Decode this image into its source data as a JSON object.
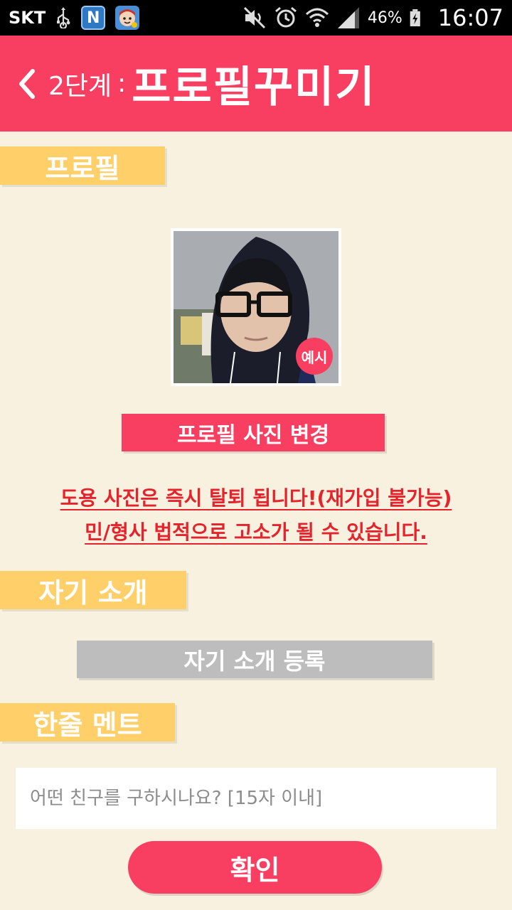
{
  "status_bar": {
    "carrier": "SKT",
    "app_icon_n": "N",
    "battery": "46%",
    "time": "16:07",
    "icons": [
      "usb-icon",
      "naver-app-icon",
      "game-app-icon",
      "mute-icon",
      "alarm-icon",
      "wifi-icon",
      "signal-icon",
      "battery-icon"
    ]
  },
  "header": {
    "step": "2단계",
    "separator": ":",
    "title": "프로필꾸미기"
  },
  "sections": {
    "profile": "프로필",
    "intro": "자기 소개",
    "comment": "한줄 멘트"
  },
  "profile": {
    "example_badge": "예시",
    "change_photo_label": "프로필 사진 변경"
  },
  "warnings": [
    "도용 사진은 즉시 탈퇴 됩니다!(재가입 불가능)",
    "민/형사 법적으로 고소가 될 수 있습니다."
  ],
  "intro": {
    "register_label": "자기 소개 등록"
  },
  "comment": {
    "value": "",
    "placeholder": "어떤 친구를 구하시나요? [15자 이내]"
  },
  "confirm_label": "확인",
  "colors": {
    "primary": "#f83f61",
    "label_yellow": "#ffcf6a",
    "background": "#f8f1df",
    "disabled_gray": "#bdbdbd",
    "warning_red": "#e4232c"
  }
}
